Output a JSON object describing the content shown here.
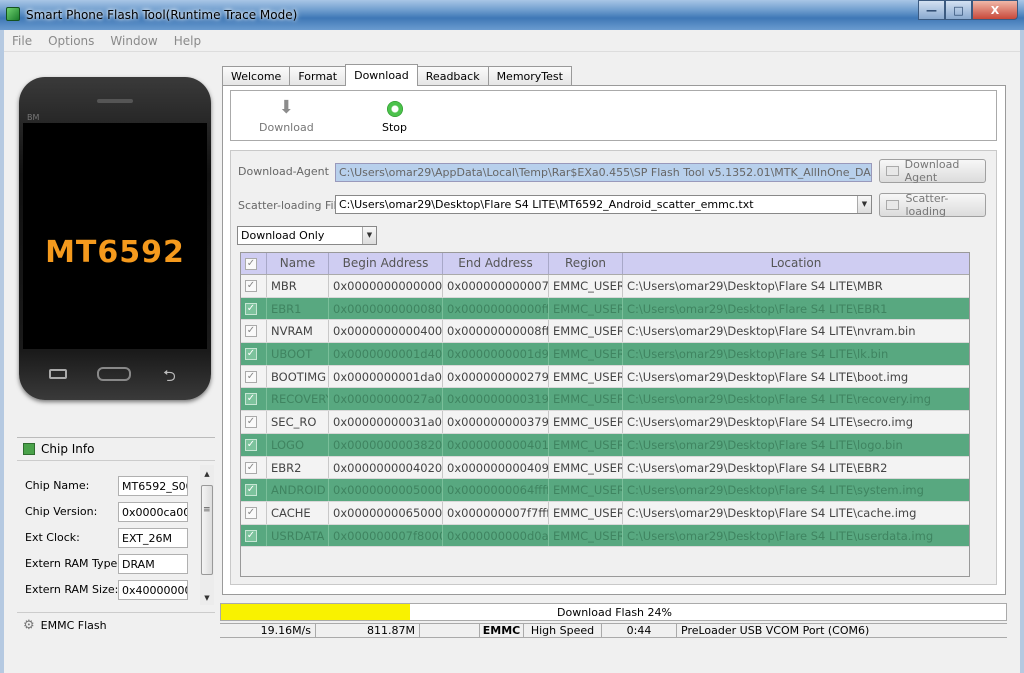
{
  "window": {
    "title": "Smart Phone Flash Tool(Runtime Trace Mode)",
    "min": "—",
    "max": "□",
    "close": "X"
  },
  "menu": [
    "File",
    "Options",
    "Window",
    "Help"
  ],
  "phone": {
    "brand": "BM",
    "chip": "MT6592"
  },
  "chip_info": {
    "header": "Chip Info",
    "rows": [
      {
        "label": "Chip Name:",
        "value": "MT6592_S00"
      },
      {
        "label": "Chip Version:",
        "value": "0x0000ca00"
      },
      {
        "label": "Ext Clock:",
        "value": "EXT_26M"
      },
      {
        "label": "Extern RAM Type:",
        "value": "DRAM"
      },
      {
        "label": "Extern RAM Size:",
        "value": "0x40000000"
      }
    ],
    "footer": "EMMC Flash"
  },
  "tabs": [
    "Welcome",
    "Format",
    "Download",
    "Readback",
    "MemoryTest"
  ],
  "toolbar": {
    "download": "Download",
    "stop": "Stop"
  },
  "download_agent": {
    "label": "Download-Agent",
    "value": "C:\\Users\\omar29\\AppData\\Local\\Temp\\Rar$EXa0.455\\SP Flash Tool v5.1352.01\\MTK_AllInOne_DA.bin",
    "button": "Download Agent"
  },
  "scatter": {
    "label": "Scatter-loading File",
    "value": "C:\\Users\\omar29\\Desktop\\Flare S4 LITE\\MT6592_Android_scatter_emmc.txt",
    "button": "Scatter-loading"
  },
  "mode": {
    "selected": "Download Only"
  },
  "table": {
    "headers": [
      "Name",
      "Begin Address",
      "End Address",
      "Region",
      "Location"
    ],
    "rows": [
      {
        "name": "MBR",
        "begin": "0x0000000000000000",
        "end": "0x000000000007ffff",
        "region": "EMMC_USER",
        "location": "C:\\Users\\omar29\\Desktop\\Flare S4 LITE\\MBR"
      },
      {
        "name": "EBR1",
        "begin": "0x0000000000080000",
        "end": "0x00000000000fffff",
        "region": "EMMC_USER",
        "location": "C:\\Users\\omar29\\Desktop\\Flare S4 LITE\\EBR1"
      },
      {
        "name": "NVRAM",
        "begin": "0x0000000000400000",
        "end": "0x00000000008fffff",
        "region": "EMMC_USER",
        "location": "C:\\Users\\omar29\\Desktop\\Flare S4 LITE\\nvram.bin"
      },
      {
        "name": "UBOOT",
        "begin": "0x0000000001d40000",
        "end": "0x0000000001d9ffff",
        "region": "EMMC_USER",
        "location": "C:\\Users\\omar29\\Desktop\\Flare S4 LITE\\lk.bin"
      },
      {
        "name": "BOOTIMG",
        "begin": "0x0000000001da0000",
        "end": "0x000000000279ffff",
        "region": "EMMC_USER",
        "location": "C:\\Users\\omar29\\Desktop\\Flare S4 LITE\\boot.img"
      },
      {
        "name": "RECOVERY",
        "begin": "0x00000000027a0000",
        "end": "0x000000000319ffff",
        "region": "EMMC_USER",
        "location": "C:\\Users\\omar29\\Desktop\\Flare S4 LITE\\recovery.img"
      },
      {
        "name": "SEC_RO",
        "begin": "0x00000000031a0000",
        "end": "0x000000000379ffff",
        "region": "EMMC_USER",
        "location": "C:\\Users\\omar29\\Desktop\\Flare S4 LITE\\secro.img"
      },
      {
        "name": "LOGO",
        "begin": "0x0000000003820000",
        "end": "0x000000000401ffff",
        "region": "EMMC_USER",
        "location": "C:\\Users\\omar29\\Desktop\\Flare S4 LITE\\logo.bin"
      },
      {
        "name": "EBR2",
        "begin": "0x0000000004020000",
        "end": "0x000000000409ffff",
        "region": "EMMC_USER",
        "location": "C:\\Users\\omar29\\Desktop\\Flare S4 LITE\\EBR2"
      },
      {
        "name": "ANDROID",
        "begin": "0x0000000005000000",
        "end": "0x0000000064ffffff",
        "region": "EMMC_USER",
        "location": "C:\\Users\\omar29\\Desktop\\Flare S4 LITE\\system.img"
      },
      {
        "name": "CACHE",
        "begin": "0x0000000065000000",
        "end": "0x000000007f7ffffff",
        "region": "EMMC_USER",
        "location": "C:\\Users\\omar29\\Desktop\\Flare S4 LITE\\cache.img"
      },
      {
        "name": "USRDATA",
        "begin": "0x000000007f800000",
        "end": "0x000000000d0affff",
        "region": "EMMC_USER",
        "location": "C:\\Users\\omar29\\Desktop\\Flare S4 LITE\\userdata.img"
      }
    ]
  },
  "progress": {
    "text": "Download Flash 24%",
    "fraction": 0.24,
    "color": "#f9f200"
  },
  "status": {
    "speed": "19.16M/s",
    "size": "811.87M",
    "blank": "",
    "type": "EMMC",
    "mode": "High Speed",
    "time": "0:44",
    "port": "PreLoader USB VCOM Port (COM6)"
  }
}
